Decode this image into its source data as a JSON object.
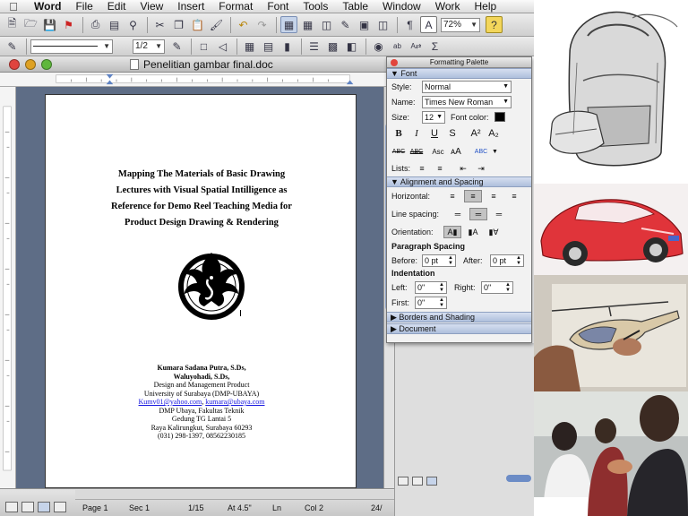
{
  "menubar": {
    "app": "Word",
    "items": [
      "File",
      "Edit",
      "View",
      "Insert",
      "Format",
      "Font",
      "Tools",
      "Table",
      "Window",
      "Work",
      "Help"
    ]
  },
  "toolbar": {
    "zoom": "72%",
    "line_weight": "1/2"
  },
  "document": {
    "window_title": "Penelitian gambar final.doc",
    "title_lines": [
      "Mapping The Materials of Basic Drawing",
      "Lectures with Visual Spatial Intilligence as",
      "Reference for Demo Reel Teaching Media for",
      "Product Design Drawing & Rendering"
    ],
    "authors": [
      "Kumara Sadana Putra, S.Ds,",
      "Waluyohadi, S.Ds,"
    ],
    "affiliation": [
      "Design and Management  Product",
      "University  of Surabaya  (DMP-UBAYA)"
    ],
    "email_1": "Kumv01@yahoo.com",
    "email_sep": ", ",
    "email_2": "kumara@ubaya.com",
    "address": [
      "DMP Ubaya, Fakultas Teknik",
      "Gedung TG Lantai 5",
      "Raya Kalirungkut, Surabaya 60293",
      "(031) 298-1397, 08562230185"
    ]
  },
  "statusbar": {
    "page": "Page   1",
    "sec": "Sec   1",
    "pages": "1/15",
    "at": "At  4.5\"",
    "ln": "Ln",
    "col": "Col  2",
    "count": "24/"
  },
  "palette": {
    "title": "Formatting Palette",
    "font_section": "Font",
    "style_label": "Style:",
    "style_value": "Normal",
    "name_label": "Name:",
    "name_value": "Times New Roman",
    "size_label": "Size:",
    "size_value": "12",
    "font_color_label": "Font color:",
    "lists_label": "Lists:",
    "align_section": "Alignment and Spacing",
    "horizontal_label": "Horizontal:",
    "line_spacing_label": "Line spacing:",
    "orientation_label": "Orientation:",
    "paragraph_spacing_label": "Paragraph Spacing",
    "before_label": "Before:",
    "before_value": "0 pt",
    "after_label": "After:",
    "after_value": "0 pt",
    "indentation_label": "Indentation",
    "left_label": "Left:",
    "left_value": "0\"",
    "right_label": "Right:",
    "right_value": "0\"",
    "first_label": "First:",
    "first_value": "0\"",
    "borders_section": "Borders and Shading",
    "document_section": "Document"
  },
  "colors": {
    "accent_section": "#aebfdc",
    "canvas": "#5e6d86",
    "link": "#1a1ae0"
  }
}
